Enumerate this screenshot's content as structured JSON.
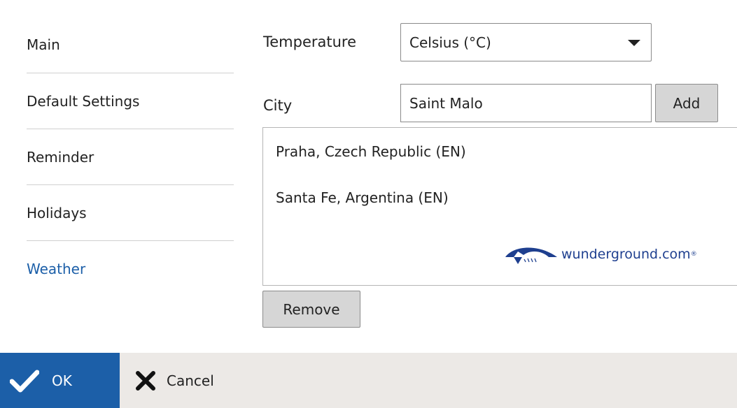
{
  "sidebar": {
    "items": [
      {
        "label": "Main"
      },
      {
        "label": "Default Settings"
      },
      {
        "label": "Reminder"
      },
      {
        "label": "Holidays"
      },
      {
        "label": "Weather",
        "active": true
      }
    ]
  },
  "form": {
    "temperature_label": "Temperature",
    "temperature_value": "Celsius (°C)",
    "city_label": "City",
    "city_value": "Saint Malo",
    "add_label": "Add",
    "cities": [
      "Praha, Czech Republic (EN)",
      "Santa Fe, Argentina (EN)"
    ],
    "provider": "wunderground.com",
    "provider_reg": "®",
    "remove_label": "Remove"
  },
  "footer": {
    "ok_label": "OK",
    "cancel_label": "Cancel"
  },
  "colors": {
    "accent": "#1c5fa8",
    "footer_bg": "#ece9e6",
    "button_bg": "#d6d6d6",
    "provider_blue": "#1e3f8f"
  },
  "icons": {
    "ok": "checkmark-icon",
    "cancel": "close-icon",
    "dropdown": "chevron-down-icon",
    "provider": "wunderground-logo"
  }
}
